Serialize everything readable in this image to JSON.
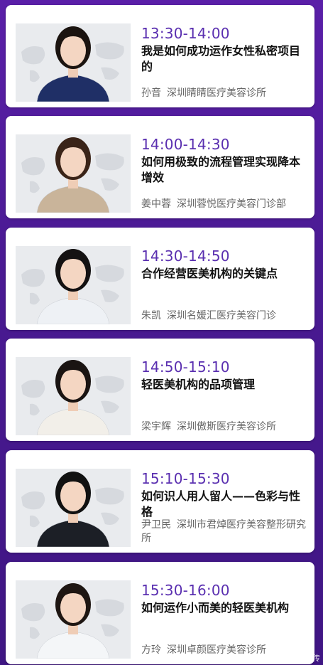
{
  "sessions": [
    {
      "time": "13:30-14:00",
      "topic": "我是如何成功运作女性私密项目的",
      "name": "孙音",
      "org": "深圳睛睛医疗美容诊所",
      "outfit": "#1f2f66",
      "hair": "#1b1410"
    },
    {
      "time": "14:00-14:30",
      "topic": "如何用极致的流程管理实现降本增效",
      "name": "姜中蓉",
      "org": "深圳蓉悦医疗美容门诊部",
      "outfit": "#c9b49a",
      "hair": "#3a2418"
    },
    {
      "time": "14:30-14:50",
      "topic": "合作经营医美机构的关键点",
      "name": "朱凯",
      "org": "深圳名媛汇医疗美容门诊",
      "outfit": "#eef1f5",
      "hair": "#141212"
    },
    {
      "time": "14:50-15:10",
      "topic": "轻医美机构的品项管理",
      "name": "梁宇辉",
      "org": "深圳傲斯医疗美容诊所",
      "outfit": "#f2efe9",
      "hair": "#1a1412"
    },
    {
      "time": "15:10-15:30",
      "topic": "如何识人用人留人——色彩与性格",
      "name": "尹卫民",
      "org": "深圳市君焯医疗美容整形研究所",
      "outfit": "#1c1f26",
      "hair": "#111111"
    },
    {
      "time": "15:30-16:00",
      "topic": "如何运作小而美的轻医美机构",
      "name": "方玲",
      "org": "深圳卓颜医疗美容诊所",
      "outfit": "#f4f6f8",
      "hair": "#1e1612"
    }
  ],
  "watermark": "©本图由平台注册用户上传"
}
